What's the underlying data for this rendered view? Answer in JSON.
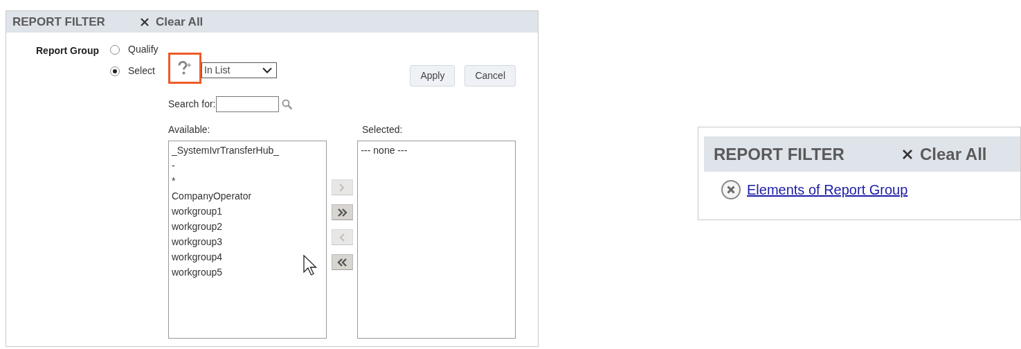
{
  "filter_panel": {
    "title": "REPORT FILTER",
    "clear_label": "Clear All",
    "field_label": "Report Group",
    "modes": [
      {
        "label": "Qualify",
        "selected": false
      },
      {
        "label": "Select",
        "selected": true
      }
    ],
    "help_highlighted": true,
    "operator": {
      "value": "In List"
    },
    "buttons": [
      "Apply",
      "Cancel"
    ],
    "search": {
      "label": "Search for:"
    },
    "available": {
      "label": "Available:",
      "items": [
        "_SystemIvrTransferHub_",
        "-",
        "*",
        "CompanyOperator",
        "workgroup1",
        "workgroup2",
        "workgroup3",
        "workgroup4",
        "workgroup5"
      ]
    },
    "transfer_buttons": [
      {
        "kind": "add",
        "disabled": true
      },
      {
        "kind": "add_all",
        "disabled": false
      },
      {
        "kind": "remove",
        "disabled": true
      },
      {
        "kind": "remove_all",
        "disabled": false
      }
    ],
    "selected": {
      "label": "Selected:",
      "items": [
        "--- none ---"
      ]
    }
  },
  "summary_panel": {
    "title": "REPORT FILTER",
    "clear_label": "Clear All",
    "filters": [
      {
        "label": "Elements of Report Group"
      }
    ]
  }
}
